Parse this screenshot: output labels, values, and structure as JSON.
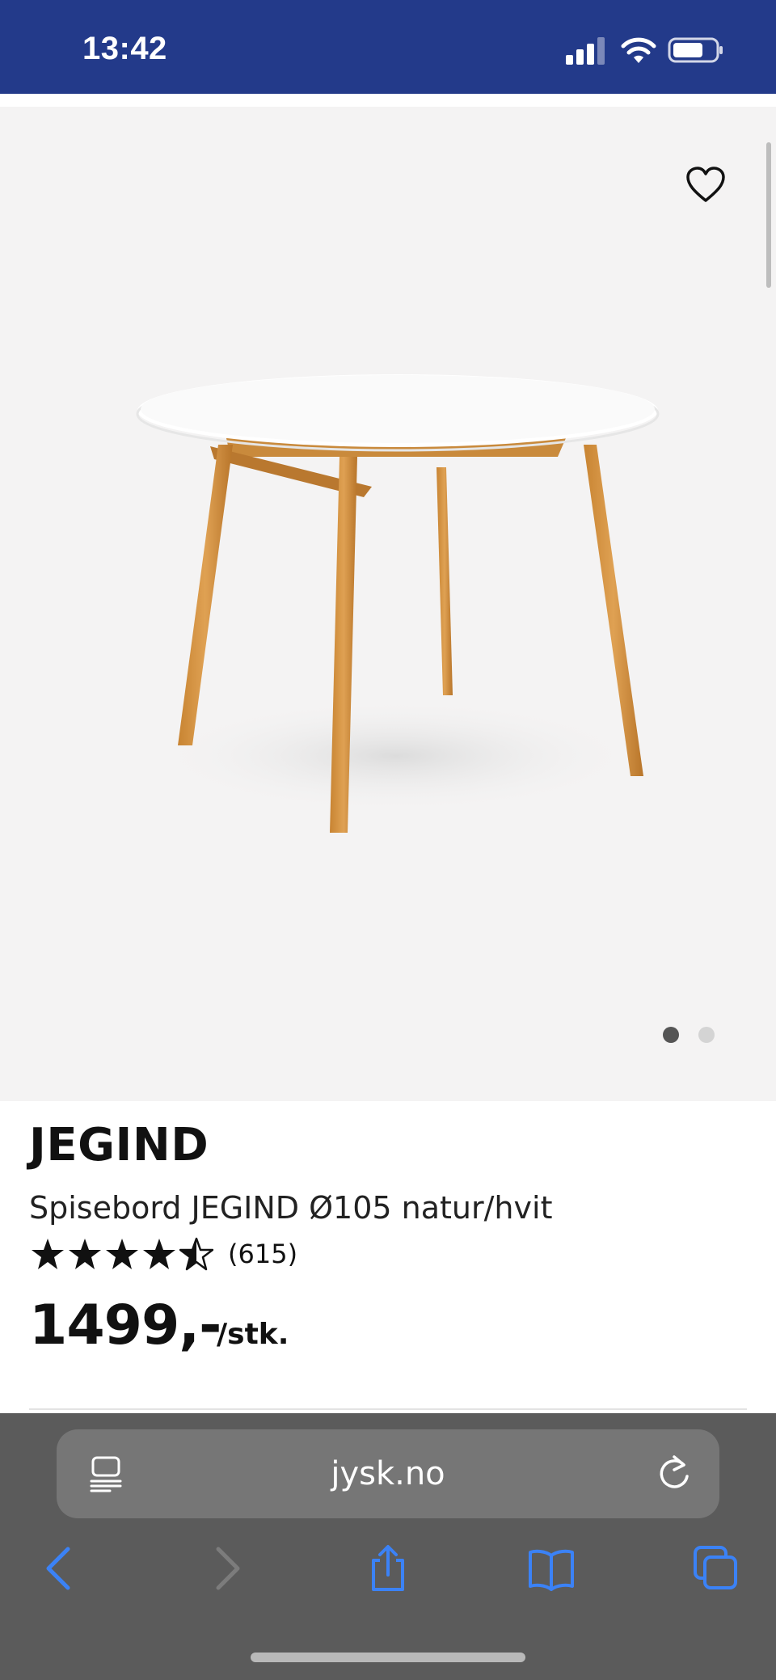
{
  "status_bar": {
    "time": "13:42",
    "background": "#233a8a",
    "icons": [
      "signal-icon",
      "wifi-icon",
      "battery-icon"
    ]
  },
  "gallery": {
    "image_alt": "table-image",
    "favorite_icon": "heart-icon",
    "slide_count": 2,
    "active_slide": 1
  },
  "product": {
    "brand": "JEGIND",
    "name": "Spisebord JEGIND Ø105 natur/hvit",
    "rating": 4.5,
    "rating_max": 5,
    "review_count": "(615)",
    "price": "1499,-",
    "unit": "/stk."
  },
  "browser": {
    "url": "jysk.no",
    "accent": "#3b82f6",
    "icons": [
      "reader-icon",
      "reload-icon",
      "back-icon",
      "forward-icon",
      "share-icon",
      "bookmarks-icon",
      "tabs-icon"
    ]
  }
}
